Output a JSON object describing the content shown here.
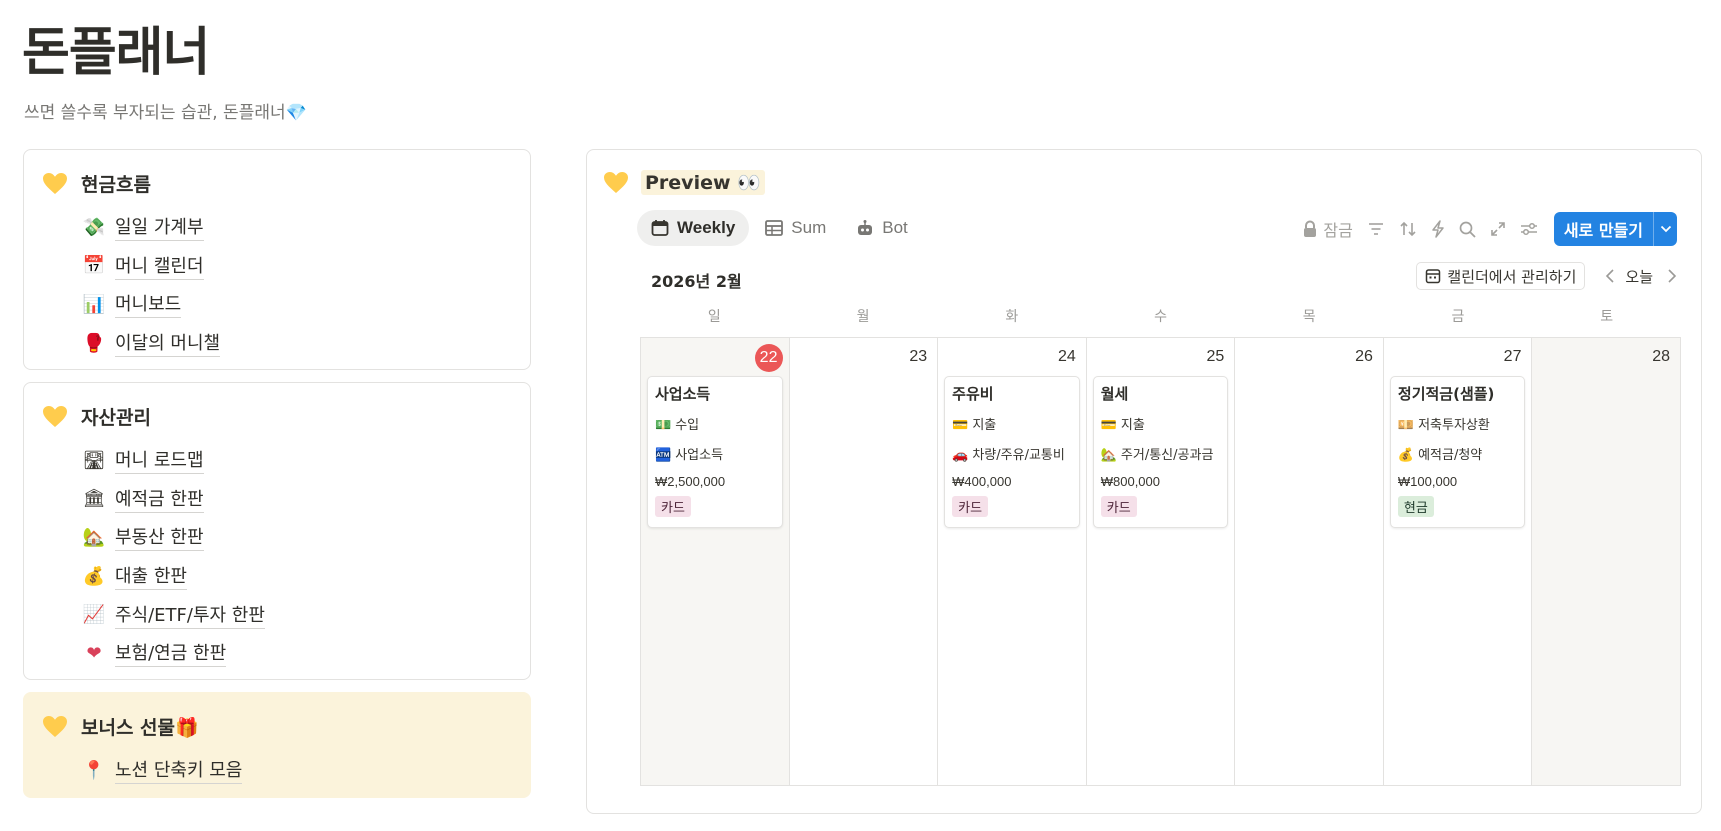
{
  "page": {
    "title": "돈플래너",
    "subtitle": "쓰면 쓸수록 부자되는 습관, 돈플래너💎"
  },
  "sidebar": {
    "sections": [
      {
        "title": "현금흐름",
        "items": [
          {
            "emoji": "💸",
            "label": "일일 가계부"
          },
          {
            "emoji": "📅",
            "label": "머니 캘린더"
          },
          {
            "emoji": "📊",
            "label": "머니보드"
          },
          {
            "emoji": "🥊",
            "label": "이달의 머니챌"
          }
        ]
      },
      {
        "title": "자산관리",
        "items": [
          {
            "emoji": "🛣",
            "label": "머니 로드맵"
          },
          {
            "emoji": "🏛",
            "label": "예적금 한판"
          },
          {
            "emoji": "🏡",
            "label": "부동산 한판"
          },
          {
            "emoji": "💰",
            "label": "대출 한판"
          },
          {
            "emoji": "📈",
            "label": "주식/ETF/투자 한판"
          },
          {
            "emoji": "❤",
            "label": "보험/연금 한판"
          }
        ]
      },
      {
        "title": "보너스 선물🎁",
        "items": [
          {
            "emoji": "📍",
            "label": "노션 단축키 모음"
          }
        ]
      }
    ]
  },
  "preview": {
    "title": "Preview 👀",
    "tabs": [
      {
        "label": "Weekly",
        "icon": "calendar-icon",
        "active": true
      },
      {
        "label": "Sum",
        "icon": "table-icon",
        "active": false
      },
      {
        "label": "Bot",
        "icon": "bot-icon",
        "active": false
      }
    ],
    "toolbar": {
      "lock_label": "잠금",
      "new_label": "새로 만들기"
    },
    "calendar": {
      "month_label": "2026년 2월",
      "manage_label": "캘린더에서 관리하기",
      "today_label": "오늘",
      "weekdays": [
        "일",
        "월",
        "화",
        "수",
        "목",
        "금",
        "토"
      ],
      "days": [
        {
          "num": "22",
          "today": true,
          "weekend": true,
          "event": {
            "title": "사업소득",
            "type_emoji": "💵",
            "type": "수입",
            "cat_emoji": "🏧",
            "category": "사업소득",
            "amount": "₩2,500,000",
            "tag": "카드",
            "tag_kind": "card"
          }
        },
        {
          "num": "23",
          "today": false,
          "weekend": false,
          "event": null
        },
        {
          "num": "24",
          "today": false,
          "weekend": false,
          "event": {
            "title": "주유비",
            "type_emoji": "💳",
            "type": "지출",
            "cat_emoji": "🚗",
            "category": "차량/주유/교통비",
            "amount": "₩400,000",
            "tag": "카드",
            "tag_kind": "card"
          }
        },
        {
          "num": "25",
          "today": false,
          "weekend": false,
          "event": {
            "title": "월세",
            "type_emoji": "💳",
            "type": "지출",
            "cat_emoji": "🏡",
            "category": "주거/통신/공과금",
            "amount": "₩800,000",
            "tag": "카드",
            "tag_kind": "card"
          }
        },
        {
          "num": "26",
          "today": false,
          "weekend": false,
          "event": null
        },
        {
          "num": "27",
          "today": false,
          "weekend": false,
          "event": {
            "title": "정기적금(샘플)",
            "type_emoji": "💴",
            "type": "저축투자상환",
            "cat_emoji": "💰",
            "category": "예적금/청약",
            "amount": "₩100,000",
            "tag": "현금",
            "tag_kind": "cash"
          }
        },
        {
          "num": "28",
          "today": false,
          "weekend": true,
          "event": null
        }
      ]
    }
  },
  "colors": {
    "accent_blue": "#2383e2",
    "today_red": "#eb5757",
    "heart_yellow": "#ffcc4d",
    "bonus_bg": "#fbf3db"
  }
}
